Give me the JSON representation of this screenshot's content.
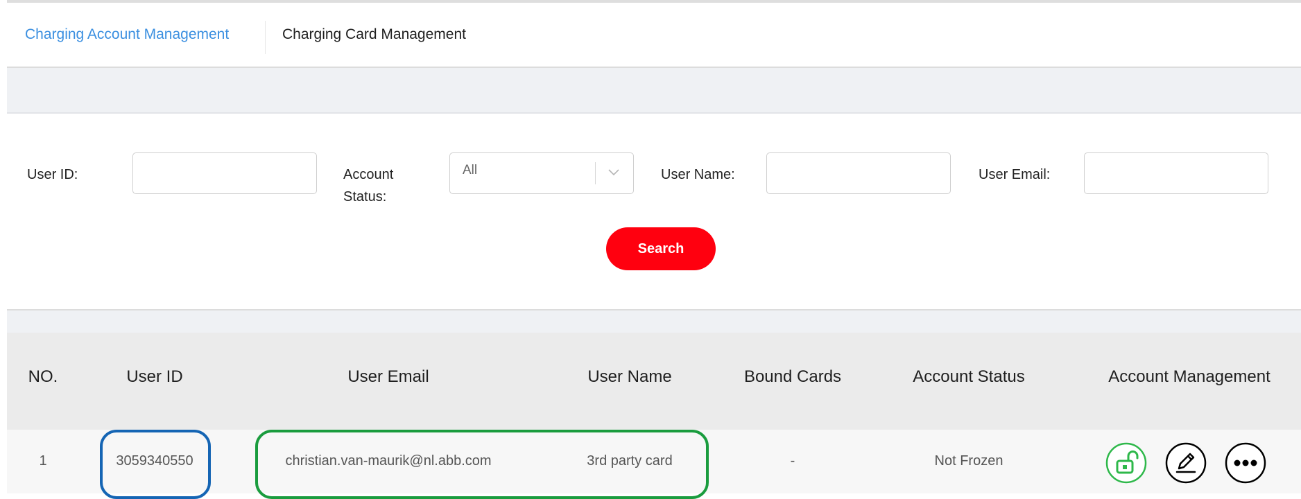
{
  "tabs": {
    "account": "Charging Account Management",
    "card": "Charging Card Management"
  },
  "filters": {
    "user_id_label": "User ID:",
    "account_status_label_line1": "Account",
    "account_status_label_line2": "Status:",
    "account_status_value": "All",
    "user_name_label": "User Name:",
    "user_email_label": "User Email:",
    "user_id_value": "",
    "user_name_value": "",
    "user_email_value": ""
  },
  "search_label": "Search",
  "table": {
    "headers": [
      "NO.",
      "User ID",
      "User Email",
      "User Name",
      "Bound Cards",
      "Account Status",
      "Account Management"
    ],
    "rows": [
      {
        "no": "1",
        "user_id": "3059340550",
        "user_email": "christian.van-maurik@nl.abb.com",
        "user_name": "3rd party card",
        "bound_cards": "-",
        "account_status": "Not Frozen"
      }
    ]
  },
  "icons": {
    "unlock": "unlock-icon",
    "edit": "edit-icon",
    "more": "more-icon"
  },
  "colors": {
    "active_tab": "#3b8fe0",
    "search_button": "#ff000f",
    "unlock_icon": "#2eb84a",
    "highlight_blue": "#1565b4",
    "highlight_green": "#1a9c3e"
  }
}
